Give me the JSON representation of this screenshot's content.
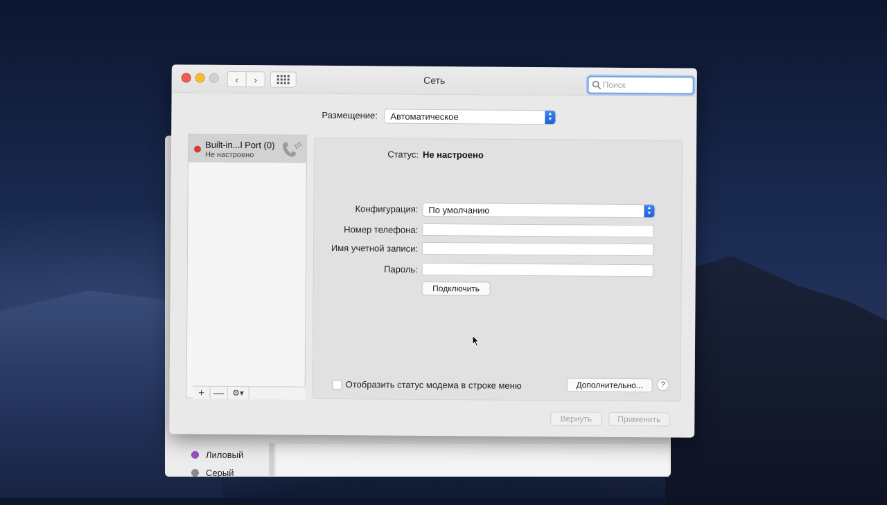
{
  "window": {
    "title": "Сеть"
  },
  "search": {
    "placeholder": "Поиск"
  },
  "location": {
    "label": "Размещение:",
    "value": "Автоматическое"
  },
  "sidebar": {
    "items": [
      {
        "name": "Built-in...l Port (0)",
        "status": "Не настроено",
        "status_color": "#d63a34",
        "icon": "phone-handset-icon"
      }
    ],
    "toolbar": {
      "add": "+",
      "remove": "—",
      "gear": "⚙▾"
    }
  },
  "detail": {
    "status_label": "Статус:",
    "status_value": "Не настроено",
    "config_label": "Конфигурация:",
    "config_value": "По умолчанию",
    "phone_label": "Номер телефона:",
    "phone_value": "",
    "account_label": "Имя учетной записи:",
    "account_value": "",
    "password_label": "Пароль:",
    "password_value": "",
    "connect_button": "Подключить",
    "show_status_label": "Отобразить статус модема в строке меню",
    "show_status_checked": false,
    "advanced_button": "Дополнительно...",
    "help_button": "?"
  },
  "footer": {
    "revert_button": "Вернуть",
    "apply_button": "Применить"
  },
  "background_window": {
    "items": [
      {
        "label": "Лиловый",
        "color": "#9b4fc2"
      },
      {
        "label": "Серый",
        "color": "#8a8a8a"
      }
    ]
  }
}
